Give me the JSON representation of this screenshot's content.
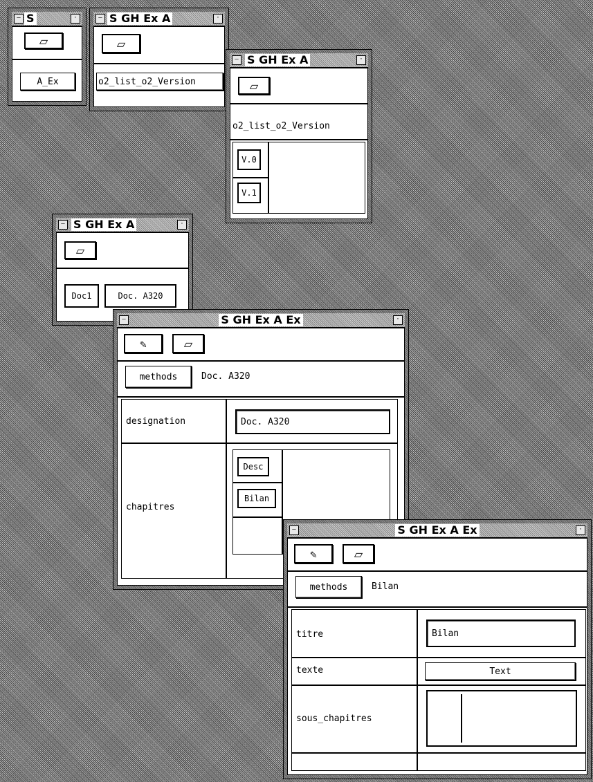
{
  "windows": {
    "w1": {
      "title": "S",
      "item": "A_Ex"
    },
    "w2": {
      "title": "S GH Ex A",
      "item": "o2_list_o2_Version"
    },
    "w3": {
      "title": "S GH Ex A",
      "label": "o2_list_o2_Version",
      "versions": [
        "V.0",
        "V.1"
      ]
    },
    "w4": {
      "title": "S GH Ex A",
      "items": [
        "Doc1",
        "Doc. A320"
      ]
    },
    "w5": {
      "title": "S GH Ex A Ex",
      "methods": "methods",
      "object_name": "Doc. A320",
      "designation_label": "designation",
      "designation_value": "Doc. A320",
      "chapitres_label": "chapitres",
      "chapitres": [
        "Desc",
        "Bilan"
      ]
    },
    "w6": {
      "title": "S GH Ex A Ex",
      "methods": "methods",
      "object_name": "Bilan",
      "titre_label": "titre",
      "titre_value": "Bilan",
      "texte_label": "texte",
      "texte_value": "Text",
      "sous_chapitres_label": "sous_chapitres"
    }
  },
  "icons": {
    "minimize": "minimize-icon",
    "close": "close-icon",
    "eraser": "eraser-icon",
    "pencil": "pencil-icon"
  }
}
